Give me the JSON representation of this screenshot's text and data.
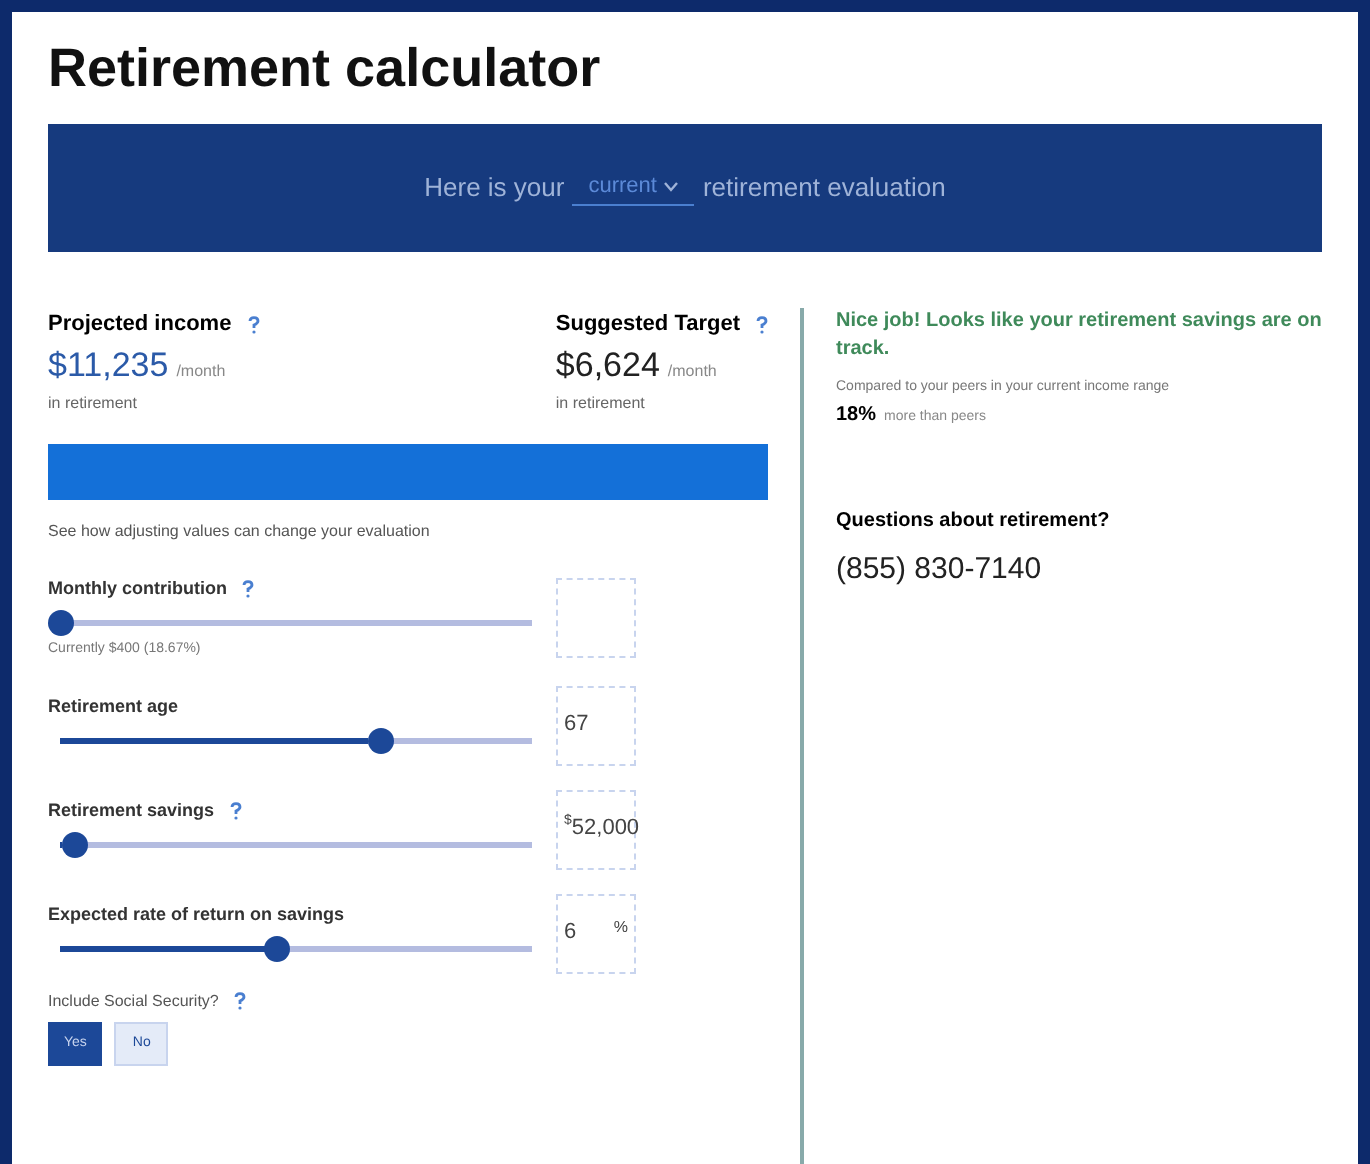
{
  "title": "Retirement calculator",
  "banner": {
    "before": "Here is your",
    "select": "current",
    "after": "retirement evaluation"
  },
  "projected": {
    "label": "Projected income",
    "amount": "$11,235",
    "unit": "/month",
    "note": "in retirement"
  },
  "target": {
    "label": "Suggested Target",
    "amount": "$6,624",
    "unit": "/month",
    "note": "in retirement"
  },
  "hint": "See how adjusting values can change your evaluation",
  "sliders": [
    {
      "label": "Monthly contribution",
      "help": true,
      "level": 0.0,
      "note": "Currently $400 (18.67%)"
    },
    {
      "label": "Retirement age",
      "help": false,
      "level": 0.68,
      "value": "67"
    },
    {
      "label": "Retirement savings",
      "help": true,
      "level": 0.03,
      "value": "52,000",
      "prefix": "$"
    },
    {
      "label": "Expected rate of return on savings",
      "help": false,
      "level": 0.46,
      "value": "6",
      "suffix": "%"
    }
  ],
  "social_security": {
    "label": "Include Social Security?",
    "options": [
      {
        "label": "Yes",
        "selected": true
      },
      {
        "label": "No",
        "selected": false
      }
    ]
  },
  "result": {
    "headline": "Nice job! Looks like your retirement savings are on track.",
    "compare": "Compared to your peers in your current income range",
    "percent": "18%",
    "percent_note": "more than peers"
  },
  "contact": {
    "question": "Questions about retirement?",
    "phone": "(855) 830-7140"
  }
}
